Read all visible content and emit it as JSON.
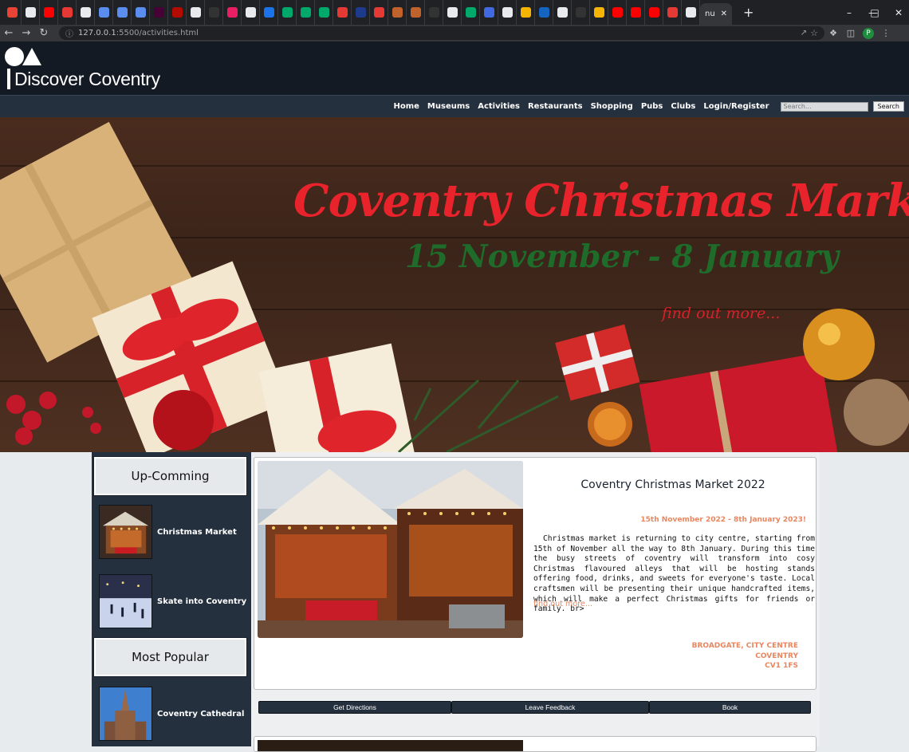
{
  "browser": {
    "tab_title": "nu",
    "url_host": "127.0.0.1",
    "url_path": ":5500/activities.html",
    "profile_initial": "P",
    "tab_favicon_colors": [
      "#ea4335",
      "#e8eaed",
      "#ff0000",
      "#e53935",
      "#e8eaed",
      "#5b8def",
      "#5b8def",
      "#5b8def",
      "#470137",
      "#b30b00",
      "#e8eaed",
      "#333333",
      "#e91e63",
      "#e8eaed",
      "#1a73e8",
      "#00a86b",
      "#00a86b",
      "#00a86b",
      "#e53935",
      "#1e3a8a",
      "#e53935",
      "#c0622b",
      "#c0622b",
      "#333333",
      "#e8eaed",
      "#00a86b",
      "#4169e1",
      "#e8eaed",
      "#f4b400",
      "#1565c0",
      "#e8eaed",
      "#333333",
      "#f4b400",
      "#ff0000",
      "#ff0000",
      "#ff0000",
      "#e53935",
      "#e8eaed"
    ]
  },
  "site": {
    "logo_text": "Discover Coventry",
    "nav": [
      "Home",
      "Museums",
      "Activities",
      "Restaurants",
      "Shopping",
      "Pubs",
      "Clubs",
      "Login/Register"
    ],
    "search_placeholder": "Search...",
    "search_button": "Search"
  },
  "hero": {
    "title": "Coventry Christmas Market",
    "dates": "15 November  -  8 January",
    "more": "find out more...",
    "colors": {
      "title": "#e8232c",
      "dates": "#1f6b2a"
    }
  },
  "sidebar": {
    "upcoming_heading": "Up-Comming",
    "upcoming_items": [
      {
        "label": "Christmas Market",
        "icon": "christmas-market-thumbnail"
      },
      {
        "label": "Skate into Coventry",
        "icon": "ice-skating-thumbnail"
      }
    ],
    "popular_heading": "Most Popular",
    "popular_items": [
      {
        "label": "Coventry Cathedral",
        "icon": "cathedral-thumbnail"
      }
    ]
  },
  "event": {
    "title": "Coventry Christmas Market 2022",
    "dates": "15th November 2022 - 8th January 2023!",
    "description": "Christmas market is returning to city centre, starting from 15th of November all the way to 8th January. During this time the busy streets of coventry will transform into cosy Christmas flavoured alleys that will be hosting stands offering food, drinks, and sweets for everyone's taste. Local craftsmen will be presenting their unique handcrafted items, which will make a perfect Christmas gifts for friends or family. br>",
    "more": "find out more...",
    "address_line1": "BROADGATE, CITY CENTRE",
    "address_line2": "COVENTRY",
    "address_line3": "CV1 1FS",
    "buttons": [
      "Get Directions",
      "Leave Feedback",
      "Book"
    ],
    "accent": "#e8865f"
  }
}
